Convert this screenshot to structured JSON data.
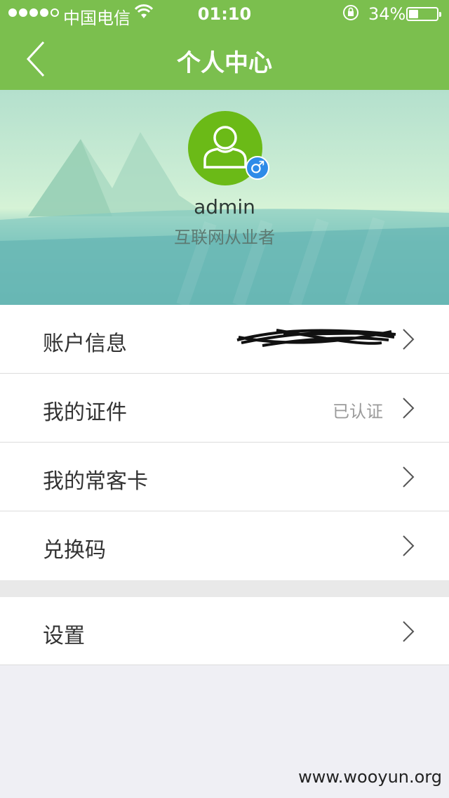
{
  "status_bar": {
    "carrier": "中国电信",
    "time": "01:10",
    "battery_pct": "34%",
    "battery_level": 0.34,
    "signal_bars_filled": 4,
    "signal_bars_total": 5,
    "wifi_icon": "wifi-icon",
    "lock_icon": "rotation-lock-icon"
  },
  "nav": {
    "title": "个人中心",
    "back_icon": "chevron-left-icon"
  },
  "profile": {
    "username": "admin",
    "profession": "互联网从业者",
    "gender_symbol": "♂",
    "avatar_icon": "user-silhouette-icon"
  },
  "menu": [
    {
      "label": "账户信息",
      "value": "",
      "redacted": true
    },
    {
      "label": "我的证件",
      "value": "已认证"
    },
    {
      "label": "我的常客卡",
      "value": ""
    },
    {
      "label": "兑换码",
      "value": ""
    }
  ],
  "menu2": [
    {
      "label": "设置",
      "value": ""
    }
  ],
  "watermark": "www.wooyun.org",
  "colors": {
    "nav_green": "#7bbf4e",
    "avatar_green": "#6bba17",
    "gender_blue": "#2e8be8"
  }
}
